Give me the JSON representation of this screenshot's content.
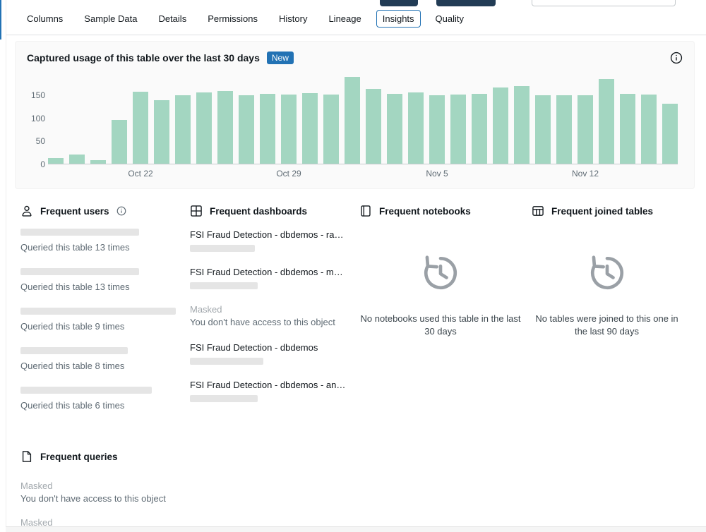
{
  "colors": {
    "accent_blue": "#2272b4",
    "bar_green": "#a3d6c1",
    "badge_blue": "#2272b4"
  },
  "tabs": [
    {
      "label": "Columns",
      "active": false
    },
    {
      "label": "Sample Data",
      "active": false
    },
    {
      "label": "Details",
      "active": false
    },
    {
      "label": "Permissions",
      "active": false
    },
    {
      "label": "History",
      "active": false
    },
    {
      "label": "Lineage",
      "active": false
    },
    {
      "label": "Insights",
      "active": true
    },
    {
      "label": "Quality",
      "active": false
    }
  ],
  "usage_card": {
    "title": "Captured usage of this table over the last 30 days",
    "badge": "New"
  },
  "chart_data": {
    "type": "bar",
    "x": [
      "Oct 18",
      "Oct 19",
      "Oct 20",
      "Oct 21",
      "Oct 22",
      "Oct 23",
      "Oct 24",
      "Oct 25",
      "Oct 26",
      "Oct 27",
      "Oct 28",
      "Oct 29",
      "Oct 30",
      "Oct 31",
      "Nov 1",
      "Nov 2",
      "Nov 3",
      "Nov 4",
      "Nov 5",
      "Nov 6",
      "Nov 7",
      "Nov 8",
      "Nov 9",
      "Nov 10",
      "Nov 11",
      "Nov 12",
      "Nov 13",
      "Nov 14",
      "Nov 15",
      "Nov 16"
    ],
    "values": [
      12,
      20,
      8,
      95,
      156,
      138,
      148,
      154,
      158,
      148,
      152,
      150,
      153,
      150,
      188,
      162,
      152,
      154,
      148,
      150,
      152,
      166,
      169,
      148,
      148,
      148,
      184,
      152,
      150,
      130
    ],
    "yticks": [
      0,
      50,
      100,
      150
    ],
    "xticks": [
      {
        "index": 4,
        "label": "Oct 22"
      },
      {
        "index": 11,
        "label": "Oct 29"
      },
      {
        "index": 18,
        "label": "Nov 5"
      },
      {
        "index": 25,
        "label": "Nov 12"
      }
    ],
    "ylim": [
      0,
      190
    ],
    "grid": false,
    "legend": false,
    "bar_color": "#a3d6c1",
    "title": "Captured usage of this table over the last 30 days"
  },
  "sections": {
    "frequent_users": {
      "title": "Frequent users",
      "items": [
        {
          "times_label": "Queried this table 13 times"
        },
        {
          "times_label": "Queried this table 13 times"
        },
        {
          "times_label": "Queried this table 9 times"
        },
        {
          "times_label": "Queried this table 8 times"
        },
        {
          "times_label": "Queried this table 6 times"
        }
      ]
    },
    "frequent_dashboards": {
      "title": "Frequent dashboards",
      "items": [
        {
          "type": "link",
          "name": "FSI Fraud Detection - dbdemos - ra…"
        },
        {
          "type": "link",
          "name": "FSI Fraud Detection - dbdemos - m…"
        },
        {
          "type": "masked",
          "label": "Masked",
          "sub": "You don't have access to this object"
        },
        {
          "type": "link",
          "name": "FSI Fraud Detection - dbdemos"
        },
        {
          "type": "link",
          "name": "FSI Fraud Detection - dbdemos - an…"
        }
      ]
    },
    "frequent_notebooks": {
      "title": "Frequent notebooks",
      "empty_text": "No notebooks used this table in the last 30 days"
    },
    "frequent_joined_tables": {
      "title": "Frequent joined tables",
      "empty_text": "No tables were joined to this one in the last 90 days"
    },
    "frequent_queries": {
      "title": "Frequent queries",
      "items": [
        {
          "label": "Masked",
          "sub": "You don't have access to this object"
        },
        {
          "label": "Masked"
        }
      ]
    }
  }
}
